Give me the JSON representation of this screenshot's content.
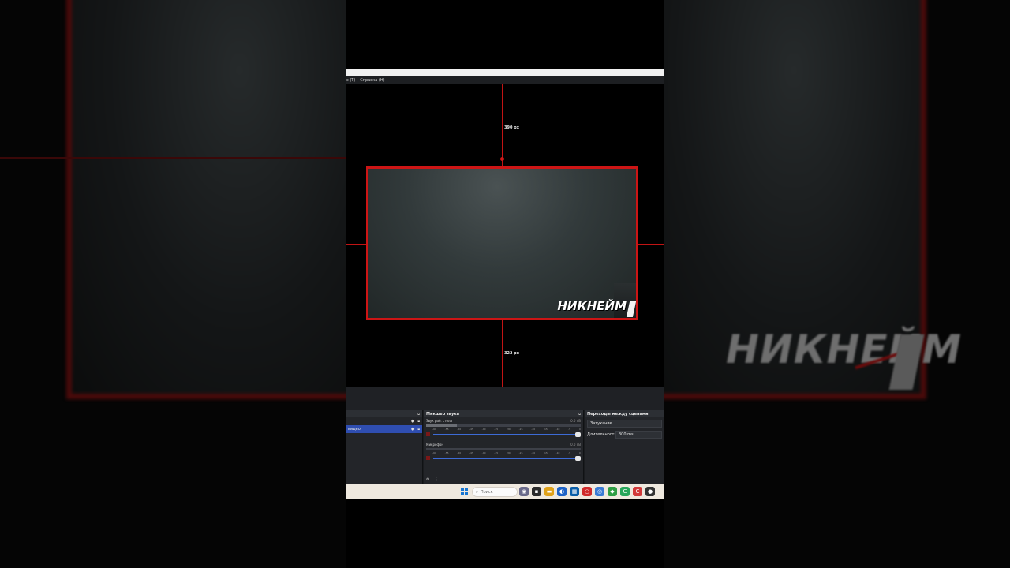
{
  "menu": {
    "items": [
      "с (T)",
      "Справка (H)"
    ]
  },
  "preview": {
    "top_distance": "390 px",
    "bottom_distance": "322 px",
    "nickname": "НИКНЕЙМ"
  },
  "background": {
    "nickname": "НИКНЕЙМ"
  },
  "sources": {
    "items": [
      {
        "label": ""
      },
      {
        "label": "видео"
      }
    ]
  },
  "mixer": {
    "title": "Микшер звука",
    "channels": [
      {
        "name": "Звук раб. стола",
        "db": "0.0 dB",
        "level": 0.2
      },
      {
        "name": "Микрофон",
        "db": "0.0 dB",
        "level": 0.0
      }
    ],
    "scale": [
      "-60",
      "-55",
      "-50",
      "-45",
      "-40",
      "-35",
      "-30",
      "-25",
      "-20",
      "-15",
      "-10",
      "-5",
      "0"
    ]
  },
  "transitions": {
    "title": "Переходы между сценами",
    "selected": "Затухание",
    "duration_label": "Длительность",
    "duration_value": "300 ms"
  },
  "taskbar": {
    "search_placeholder": "Поиск"
  },
  "colors": {
    "guide_red": "#cc1515",
    "selection_blue": "#2f4eb1",
    "taskbar_bg": "#efe9df"
  }
}
